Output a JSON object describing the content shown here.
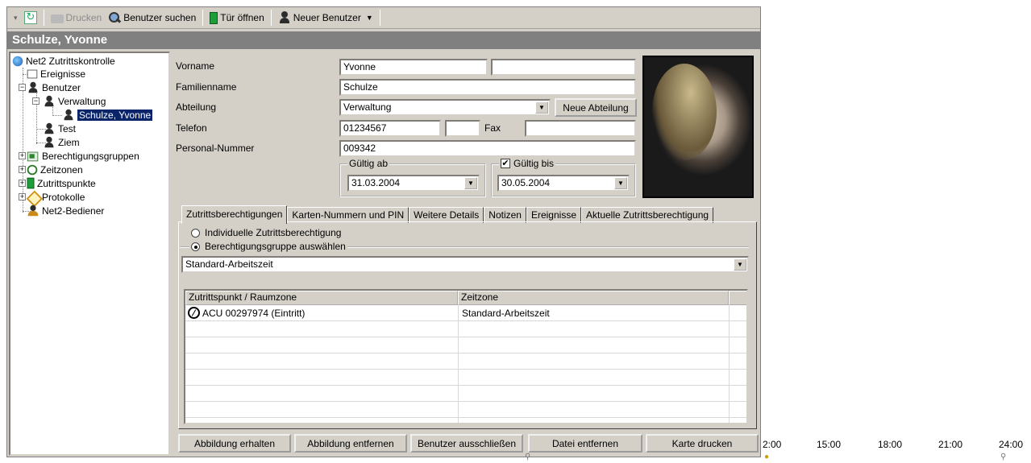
{
  "toolbar": {
    "print_label": "Drucken",
    "search_label": "Benutzer suchen",
    "open_door_label": "Tür öffnen",
    "new_user_label": "Neuer Benutzer"
  },
  "title": "Schulze, Yvonne",
  "tree": {
    "root": "Net2 Zutrittskontrolle",
    "events": "Ereignisse",
    "users": "Benutzer",
    "admin": "Verwaltung",
    "selected_user": "Schulze, Yvonne",
    "test": "Test",
    "ziem": "Ziem",
    "groups": "Berechtigungsgruppen",
    "timezones": "Zeitzonen",
    "access_points": "Zutrittspunkte",
    "logs": "Protokolle",
    "operators": "Net2-Bediener"
  },
  "form": {
    "first_name_label": "Vorname",
    "first_name": "Yvonne",
    "first_name_extra": "",
    "last_name_label": "Familienname",
    "last_name": "Schulze",
    "department_label": "Abteilung",
    "department": "Verwaltung",
    "new_department": "Neue Abteilung",
    "phone_label": "Telefon",
    "phone": "01234567",
    "phone_ext": "",
    "fax_label": "Fax",
    "fax": "",
    "personnel_label": "Personal-Nummer",
    "personnel_no": "009342",
    "valid_from_label": "Gültig ab",
    "valid_from": "31.03.2004",
    "valid_until_label": "Gültig bis",
    "valid_until_checked": "✔",
    "valid_until": "30.05.2004"
  },
  "tabs": [
    "Zutrittsberechtigungen",
    "Karten-Nummern und PIN",
    "Weitere Details",
    "Notizen",
    "Ereignisse",
    "Aktuelle Zutrittsberechtigung"
  ],
  "access": {
    "individual": "Individuelle Zutrittsberechtigung",
    "group_select": "Berechtigungsgruppe auswählen",
    "group_value": "Standard-Arbeitszeit",
    "columns": [
      "Zutrittspunkt / Raumzone",
      "Zeitzone"
    ],
    "rows": [
      [
        "ACU 00297974 (Eintritt)",
        "Standard-Arbeitszeit"
      ]
    ]
  },
  "buttons": {
    "get_image": "Abbildung erhalten",
    "remove_image": "Abbildung entfernen",
    "exclude_user": "Benutzer ausschließen",
    "remove_file": "Datei entfernen",
    "print_card": "Karte drucken"
  },
  "timeline": [
    "2:00",
    "15:00",
    "18:00",
    "21:00",
    "24:00"
  ]
}
